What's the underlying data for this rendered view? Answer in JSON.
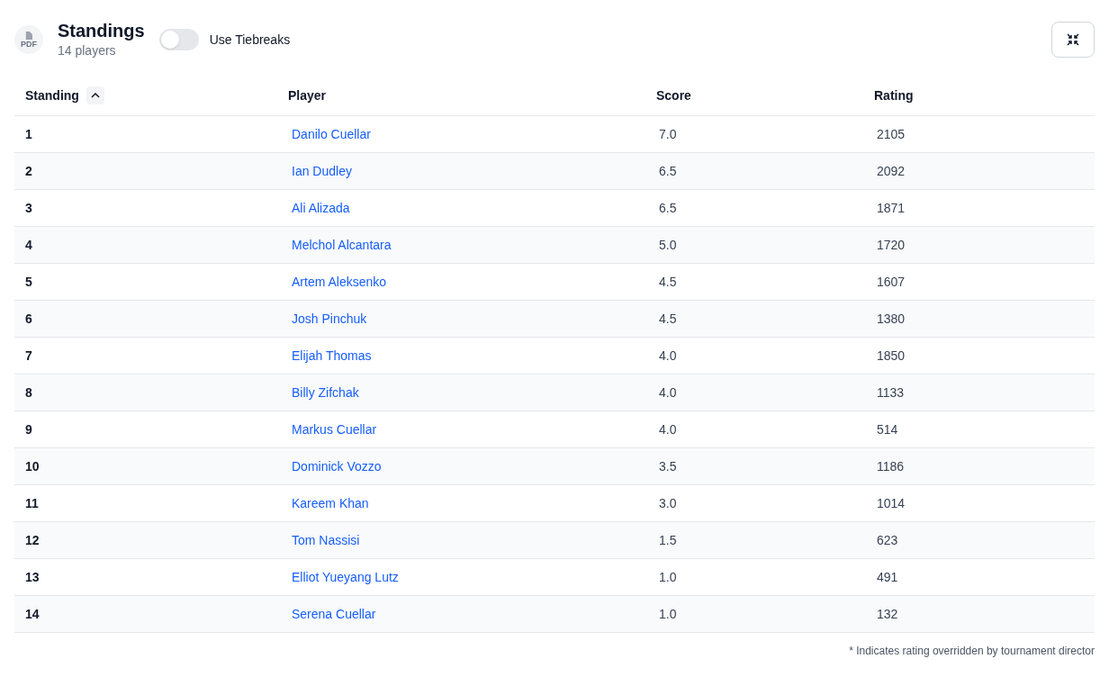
{
  "header": {
    "pdf_label": "PDF",
    "title": "Standings",
    "subtitle": "14 players",
    "toggle": {
      "label": "Use Tiebreaks",
      "on": false
    }
  },
  "table": {
    "columns": [
      {
        "label": "Standing",
        "sort_ascending": true
      },
      {
        "label": "Player"
      },
      {
        "label": "Score"
      },
      {
        "label": "Rating"
      }
    ],
    "rows": [
      {
        "standing": "1",
        "player": "Danilo Cuellar",
        "score": "7.0",
        "rating": "2105"
      },
      {
        "standing": "2",
        "player": "Ian Dudley",
        "score": "6.5",
        "rating": "2092"
      },
      {
        "standing": "3",
        "player": "Ali Alizada",
        "score": "6.5",
        "rating": "1871"
      },
      {
        "standing": "4",
        "player": "Melchol Alcantara",
        "score": "5.0",
        "rating": "1720"
      },
      {
        "standing": "5",
        "player": "Artem Aleksenko",
        "score": "4.5",
        "rating": "1607"
      },
      {
        "standing": "6",
        "player": "Josh Pinchuk",
        "score": "4.5",
        "rating": "1380"
      },
      {
        "standing": "7",
        "player": "Elijah Thomas",
        "score": "4.0",
        "rating": "1850"
      },
      {
        "standing": "8",
        "player": "Billy Zifchak",
        "score": "4.0",
        "rating": "1133"
      },
      {
        "standing": "9",
        "player": "Markus Cuellar",
        "score": "4.0",
        "rating": "514"
      },
      {
        "standing": "10",
        "player": "Dominick Vozzo",
        "score": "3.5",
        "rating": "1186"
      },
      {
        "standing": "11",
        "player": "Kareem Khan",
        "score": "3.0",
        "rating": "1014"
      },
      {
        "standing": "12",
        "player": "Tom Nassisi",
        "score": "1.5",
        "rating": "623"
      },
      {
        "standing": "13",
        "player": "Elliot Yueyang Lutz",
        "score": "1.0",
        "rating": "491"
      },
      {
        "standing": "14",
        "player": "Serena Cuellar",
        "score": "1.0",
        "rating": "132"
      }
    ]
  },
  "footnote": "* Indicates rating overridden by tournament director"
}
